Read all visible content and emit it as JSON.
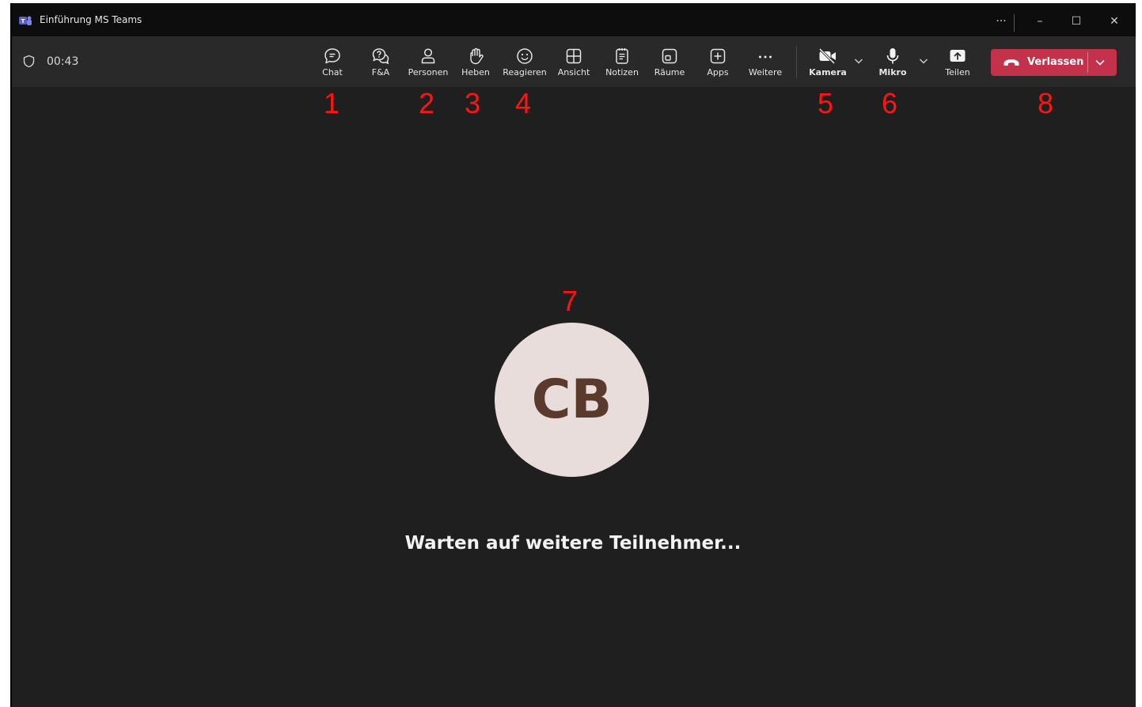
{
  "window": {
    "title": "Einführung MS Teams",
    "more": "···",
    "minimize": "–",
    "maximize": "☐",
    "close": "✕"
  },
  "toolbar": {
    "timer": "00:43",
    "buttons": [
      {
        "label": "Chat",
        "icon": "chat-icon"
      },
      {
        "label": "F&A",
        "icon": "qa-icon"
      },
      {
        "label": "Personen",
        "icon": "people-icon"
      },
      {
        "label": "Heben",
        "icon": "raise-hand-icon"
      },
      {
        "label": "Reagieren",
        "icon": "react-icon"
      },
      {
        "label": "Ansicht",
        "icon": "view-icon"
      },
      {
        "label": "Notizen",
        "icon": "notes-icon"
      },
      {
        "label": "Räume",
        "icon": "rooms-icon"
      },
      {
        "label": "Apps",
        "icon": "apps-icon"
      },
      {
        "label": "Weitere",
        "icon": "more-icon"
      }
    ],
    "camera": {
      "label": "Kamera",
      "icon": "camera-off-icon"
    },
    "mic": {
      "label": "Mikro",
      "icon": "microphone-icon"
    },
    "share": {
      "label": "Teilen",
      "icon": "share-icon"
    },
    "leave": {
      "label": "Verlassen",
      "icon": "phone-hangup-icon",
      "color": "#c4314b"
    }
  },
  "annotations": [
    "1",
    "2",
    "3",
    "4",
    "5",
    "6",
    "7",
    "8"
  ],
  "stage": {
    "avatar_initials": "CB",
    "message": "Warten auf weitere Teilnehmer..."
  },
  "colors": {
    "background": "#1f1f1f",
    "toolbar": "#292929",
    "annotation": "#ff1414",
    "avatar_bg": "#e8ddda"
  }
}
